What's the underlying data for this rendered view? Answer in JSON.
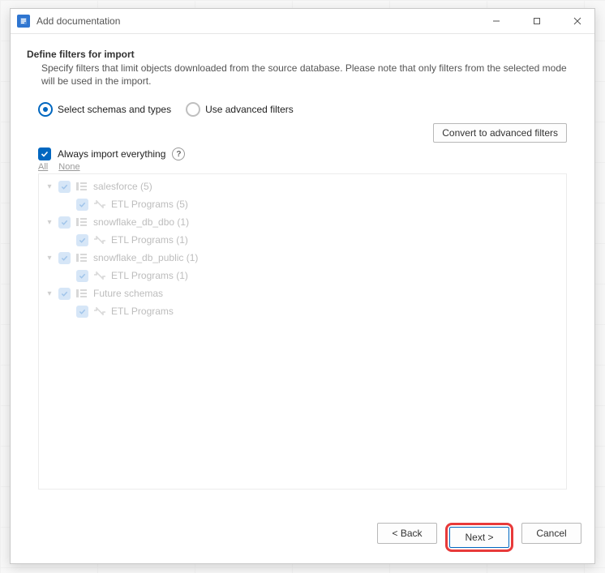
{
  "window": {
    "title": "Add documentation"
  },
  "heading": "Define filters for import",
  "description": "Specify filters that limit objects downloaded from the source database. Please note that only filters from the selected mode will be used in the import.",
  "mode": {
    "selected_label": "Select schemas and types",
    "advanced_label": "Use advanced filters"
  },
  "convert_button": "Convert to advanced filters",
  "always": {
    "label": "Always import everything",
    "checked": true
  },
  "links": {
    "all": "All",
    "none": "None"
  },
  "tree": [
    {
      "label": "salesforce (5)",
      "child": "ETL Programs (5)"
    },
    {
      "label": "snowflake_db_dbo (1)",
      "child": "ETL Programs (1)"
    },
    {
      "label": "snowflake_db_public (1)",
      "child": "ETL Programs (1)"
    },
    {
      "label": "Future schemas",
      "child": "ETL Programs"
    }
  ],
  "footer": {
    "back": "< Back",
    "next": "Next >",
    "cancel": "Cancel"
  }
}
